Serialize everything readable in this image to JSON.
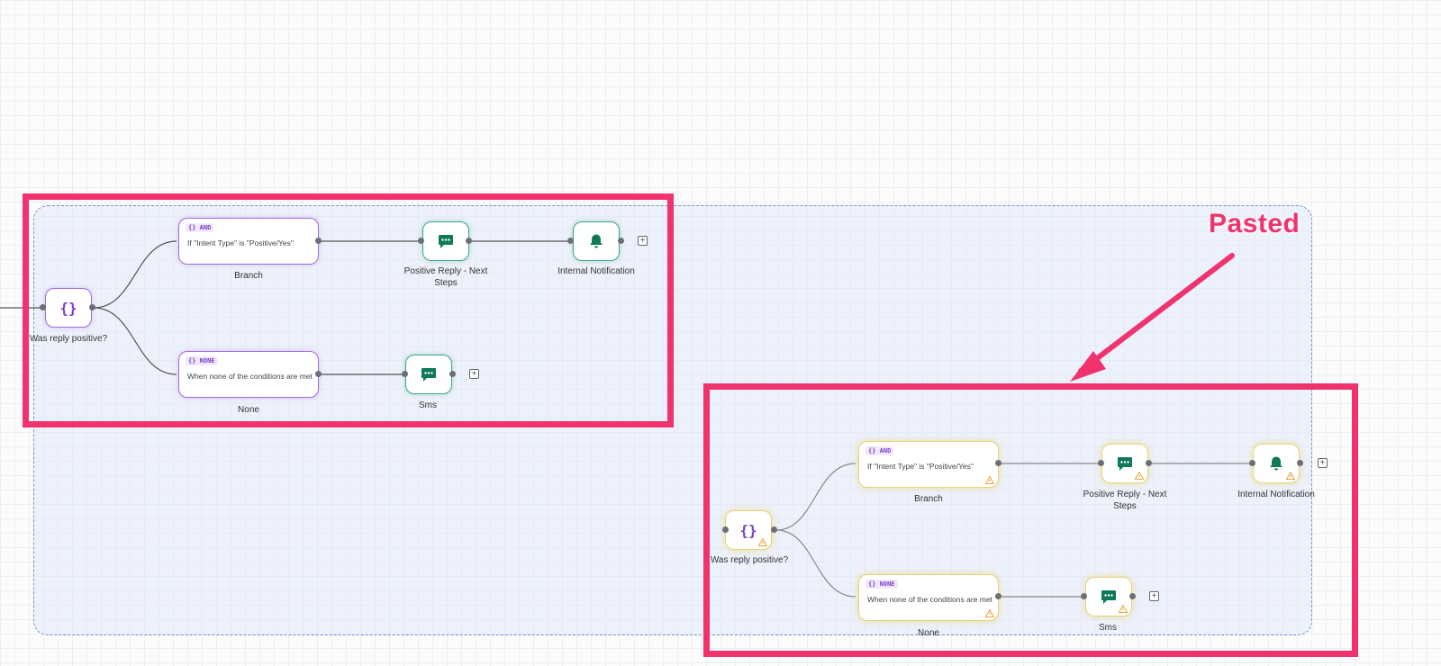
{
  "annotation": {
    "label": "Pasted"
  },
  "original": {
    "start": {
      "label": "Was reply positive?"
    },
    "branch_and": {
      "tag": "{} AND",
      "condition": "If \"Intent Type\" is \"Positive/Yes\"",
      "label": "Branch"
    },
    "branch_none": {
      "tag": "{} NONE",
      "condition": "When none of the conditions are met",
      "label": "None"
    },
    "reply": {
      "label": "Positive Reply - Next Steps"
    },
    "notify": {
      "label": "Internal Notification"
    },
    "sms": {
      "label": "Sms"
    }
  },
  "pasted": {
    "start": {
      "label": "Was reply positive?"
    },
    "branch_and": {
      "tag": "{} AND",
      "condition": "If \"Intent Type\" is \"Positive/Yes\"",
      "label": "Branch"
    },
    "branch_none": {
      "tag": "{} NONE",
      "condition": "When none of the conditions are met",
      "label": "None"
    },
    "reply": {
      "label": "Positive Reply - Next Steps"
    },
    "notify": {
      "label": "Internal Notification"
    },
    "sms": {
      "label": "Sms"
    }
  },
  "colors": {
    "highlight": "#f0336d",
    "branch": "#a46ce0",
    "action": "#0f7a5a",
    "warning": "#e9a23b"
  },
  "icons": {
    "condition": "braces-icon",
    "message": "message-icon",
    "notification": "bell-icon",
    "warning": "warning-icon",
    "add": "plus-icon"
  }
}
